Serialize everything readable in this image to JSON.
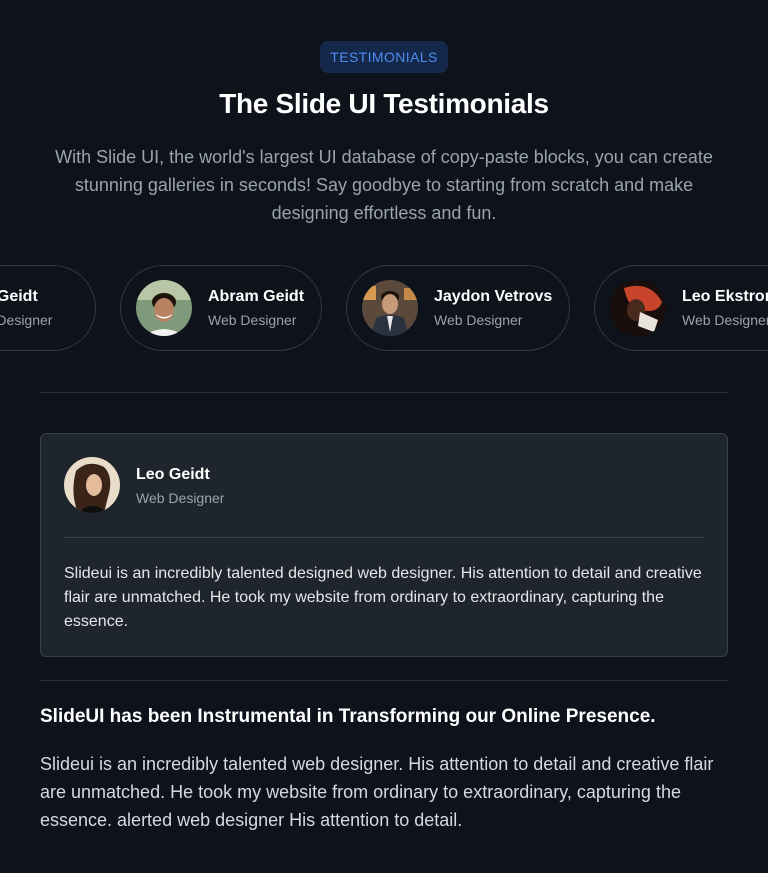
{
  "badge": "TESTIMONIALS",
  "title": "The Slide UI Testimonials",
  "subtitle": "With Slide UI, the world's largest UI database of copy-paste blocks, you can create stunning galleries in seconds! Say goodbye to starting from scratch and make designing effortless and fun.",
  "people": [
    {
      "name": "Leo Geidt",
      "role": "Web Designer"
    },
    {
      "name": "Abram Geidt",
      "role": "Web Designer"
    },
    {
      "name": "Jaydon Vetrovs",
      "role": "Web Designer"
    },
    {
      "name": "Leo Ekstrom",
      "role": "Web Designer"
    }
  ],
  "featured": {
    "name": "Leo Geidt",
    "role": "Web Designer",
    "quote": "Slideui is an incredibly talented designed web designer. His attention to detail and creative flair are unmatched. He took my website from ordinary to extraordinary, capturing the essence."
  },
  "headline": "SlideUI has been Instrumental in Transforming our Online Presence.",
  "body": "Slideui is an incredibly talented web designer. His attention to detail and creative flair are unmatched. He took my website from ordinary to extraordinary, capturing the essence. alerted web designer His attention to detail."
}
